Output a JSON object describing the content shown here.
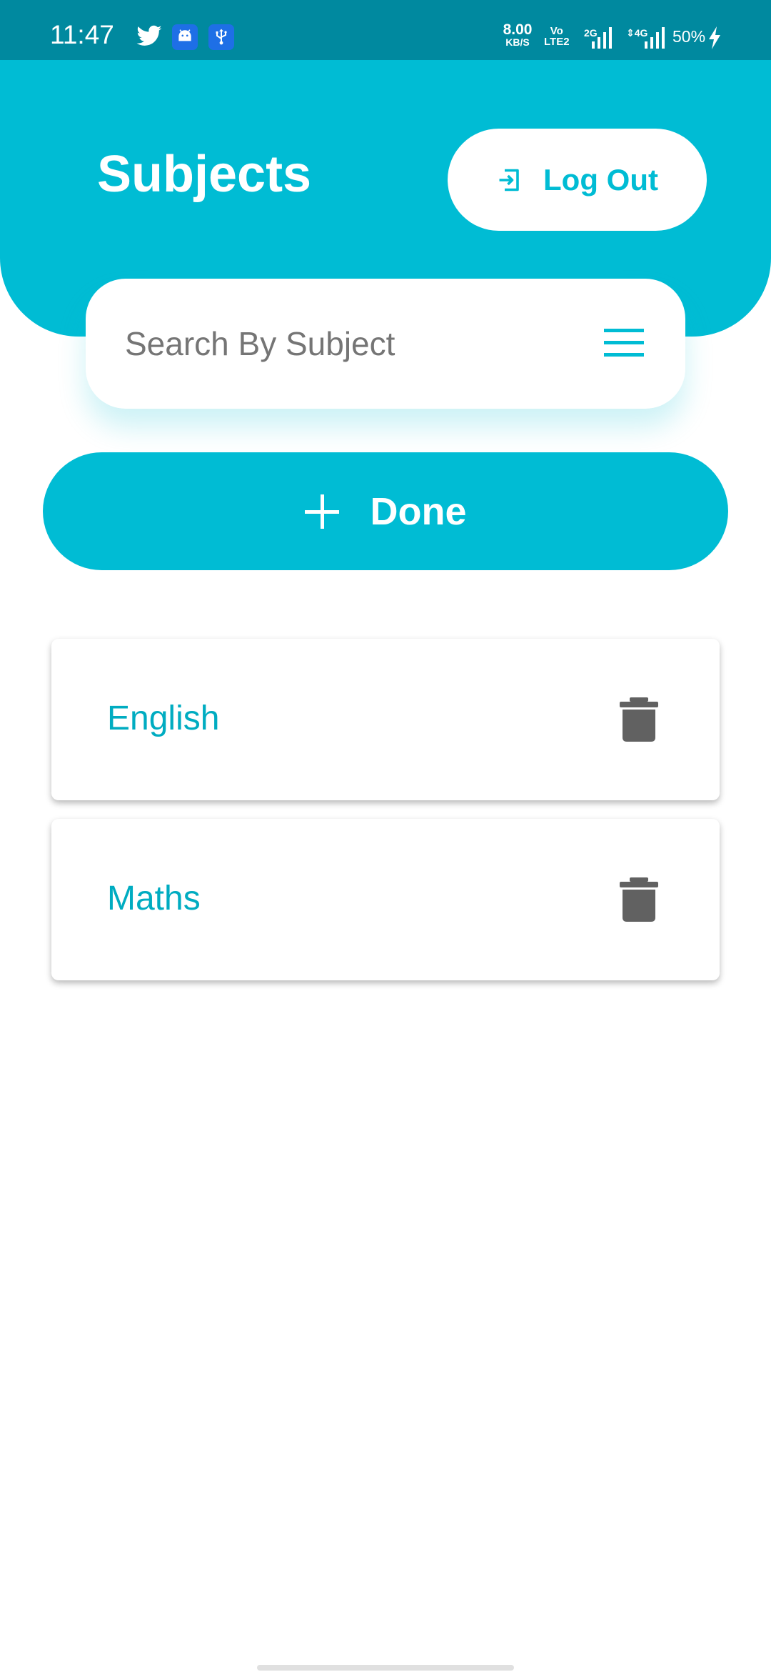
{
  "status_bar": {
    "time": "11:47",
    "net_speed_value": "8.00",
    "net_speed_unit": "KB/S",
    "volte_line1": "Vo",
    "volte_line2": "LTE2",
    "sim1_label": "2G",
    "sim2_label": "4G",
    "battery": "50%",
    "icons": [
      "twitter-icon",
      "android-icon",
      "usb-icon",
      "charging-icon"
    ]
  },
  "header": {
    "title": "Subjects",
    "logout_label": "Log Out"
  },
  "search": {
    "placeholder": "Search By Subject",
    "value": ""
  },
  "done_button": {
    "label": "Done"
  },
  "subjects": [
    {
      "name": "English"
    },
    {
      "name": "Maths"
    }
  ],
  "colors": {
    "status_bar": "#00899f",
    "primary": "#00bcd4",
    "subject_text": "#00acc1",
    "delete_icon": "#616161",
    "placeholder": "#757575"
  }
}
